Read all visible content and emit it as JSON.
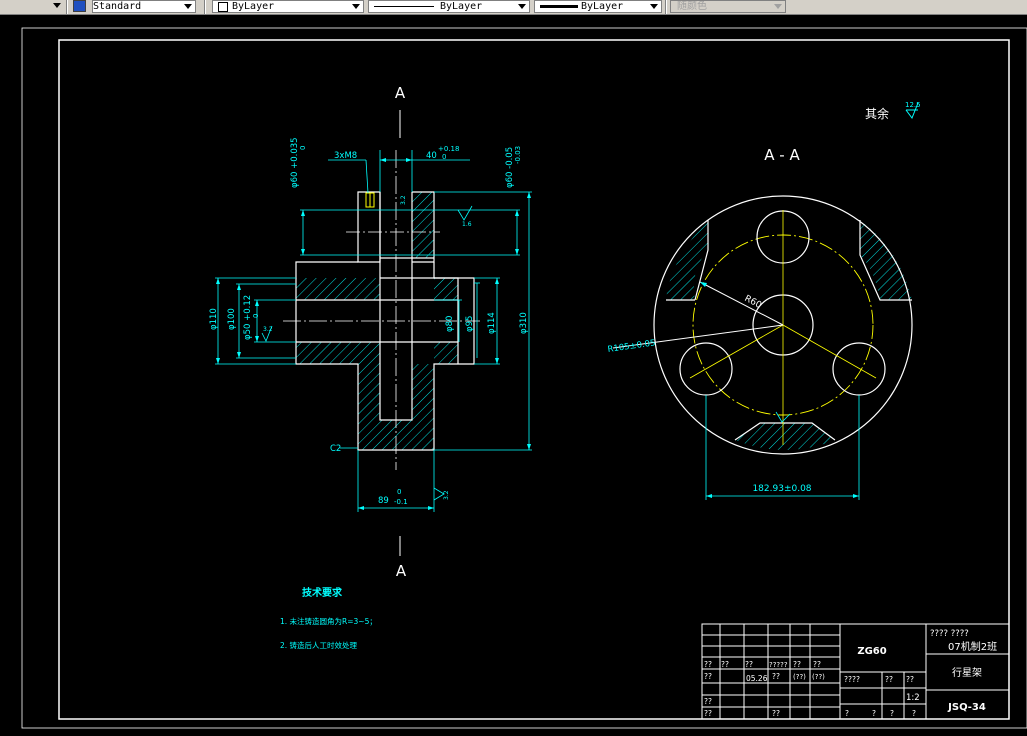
{
  "toolbar": {
    "text_style": "Standard",
    "layer_combo": "ByLayer",
    "linetype_combo": "ByLayer",
    "lineweight_combo": "ByLayer",
    "color_combo": "随颜色"
  },
  "drawing": {
    "section_label_top": "A",
    "section_label_bottom": "A",
    "section_title": "A - A",
    "roughness_rest_label": "其余",
    "roughness_rest_value": "12.5",
    "dim_3xM8": "3xM8",
    "dim_40": "40",
    "dim_40_upper": "+0.18",
    "dim_40_lower": "0",
    "dim_phi60_left": "φ60 +0.035",
    "dim_phi60_left_lower": "0",
    "dim_phi60_right": "φ60 -0.05",
    "dim_phi60_right_lower": "-0.03",
    "dim_rough_16": "1.6",
    "dim_rough_32_a": "3.2",
    "dim_rough_32_b": "3.2",
    "dim_rough_32_c": "3.2",
    "dim_phi110": "φ110",
    "dim_phi100": "φ100",
    "dim_phi50": "φ50 +0.12",
    "dim_phi50_lower": "0",
    "dim_phi80": "φ80",
    "dim_phi95": "φ95",
    "dim_phi114": "φ114",
    "dim_phi310": "φ310",
    "dim_c2": "C2",
    "dim_89": "89",
    "dim_89_upper": "0",
    "dim_89_lower": "-0.1",
    "dim_r60": "R60",
    "dim_r105": "R105±0.05",
    "dim_18293": "182.93±0.08",
    "tech_title": "技术要求",
    "tech_item_1": "1. 未注铸造圆角为R=3~5；",
    "tech_item_2": "2. 铸造后人工时效处理"
  },
  "title_block": {
    "material": "ZG60",
    "school": "???? ????",
    "class": "07机制2班",
    "part_name": "行星架",
    "drawing_no": "JSQ-34",
    "date": "05.26",
    "scale": "1:2",
    "designer": "????",
    "q": "??",
    "q5": "?????",
    "q1": "?",
    "paren_q": "(??)"
  }
}
